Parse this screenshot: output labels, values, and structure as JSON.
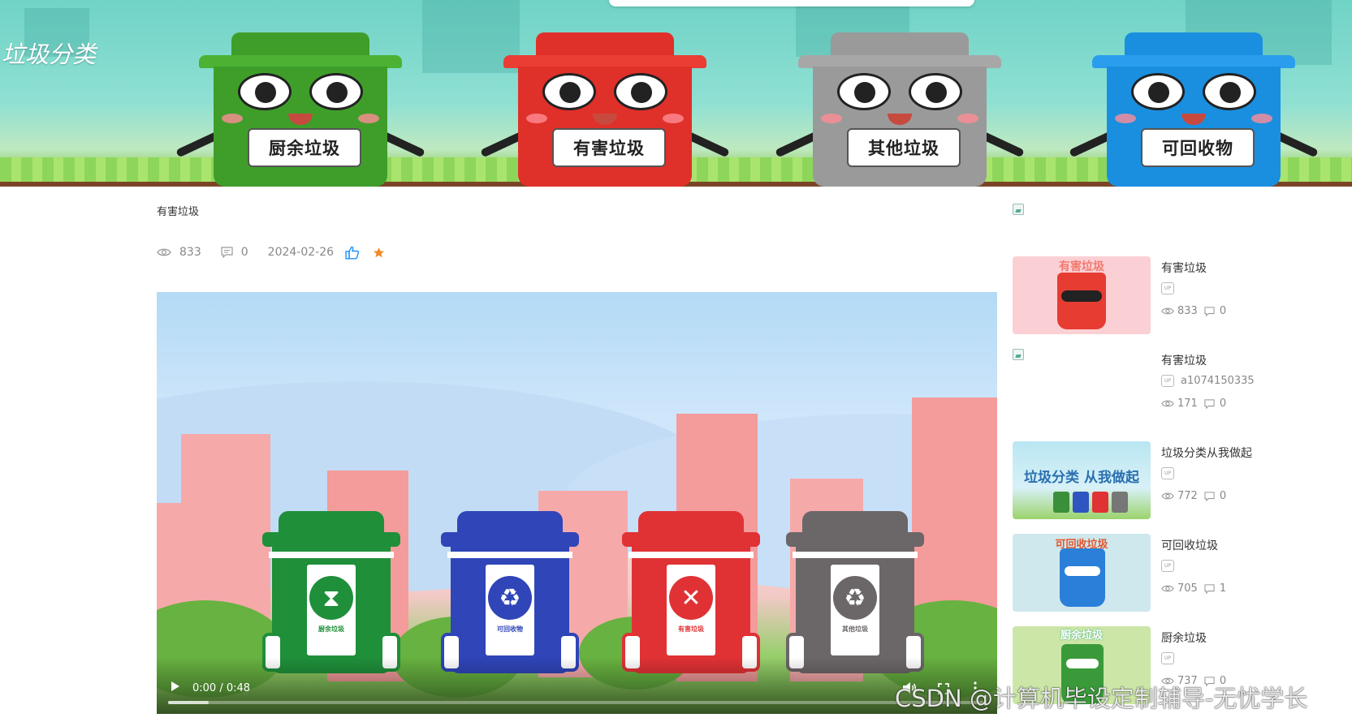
{
  "site": {
    "title": "垃圾分类"
  },
  "banner": {
    "bins": [
      {
        "label": "厨余垃圾",
        "color": "#3f9e2a"
      },
      {
        "label": "有害垃圾",
        "color": "#e0302a"
      },
      {
        "label": "其他垃圾",
        "color": "#9a9a9a"
      },
      {
        "label": "可回收物",
        "color": "#1a8fe0"
      }
    ]
  },
  "article": {
    "title": "有害垃圾",
    "views": "833",
    "comments": "0",
    "date": "2024-02-26"
  },
  "video": {
    "time": "0:00 / 0:48",
    "progress": 0.05,
    "bins": [
      {
        "caption": "厨余垃圾",
        "color": "#1f8f3a",
        "symbol": "⧗"
      },
      {
        "caption": "可回收物",
        "color": "#2f45b8",
        "symbol": "♻"
      },
      {
        "caption": "有害垃圾",
        "color": "#e03235",
        "symbol": "✕"
      },
      {
        "caption": "其他垃圾",
        "color": "#6b6668",
        "symbol": "♻"
      }
    ]
  },
  "sidebar": {
    "items": [
      {
        "title": "有害垃圾",
        "user": "",
        "views": "833",
        "comments": "0",
        "thumb": "有害垃圾",
        "thumb_bg": "#fbd0d4"
      },
      {
        "title": "有害垃圾",
        "user": "a1074150335",
        "views": "171",
        "comments": "0",
        "thumb": "",
        "thumb_bg": ""
      },
      {
        "title": "垃圾分类从我做起",
        "user": "",
        "views": "772",
        "comments": "0",
        "thumb": "垃圾分类 从我做起",
        "thumb_bg": "#b9e6f2"
      },
      {
        "title": "可回收垃圾",
        "user": "",
        "views": "705",
        "comments": "1",
        "thumb": "可回收垃圾",
        "thumb_bg": "#cfe8ee"
      },
      {
        "title": "厨余垃圾",
        "user": "",
        "views": "737",
        "comments": "0",
        "thumb": "厨余垃圾",
        "thumb_bg": "#cbe6a6"
      }
    ]
  },
  "watermark": "CSDN @计算机毕设定制辅导-无忧学长"
}
